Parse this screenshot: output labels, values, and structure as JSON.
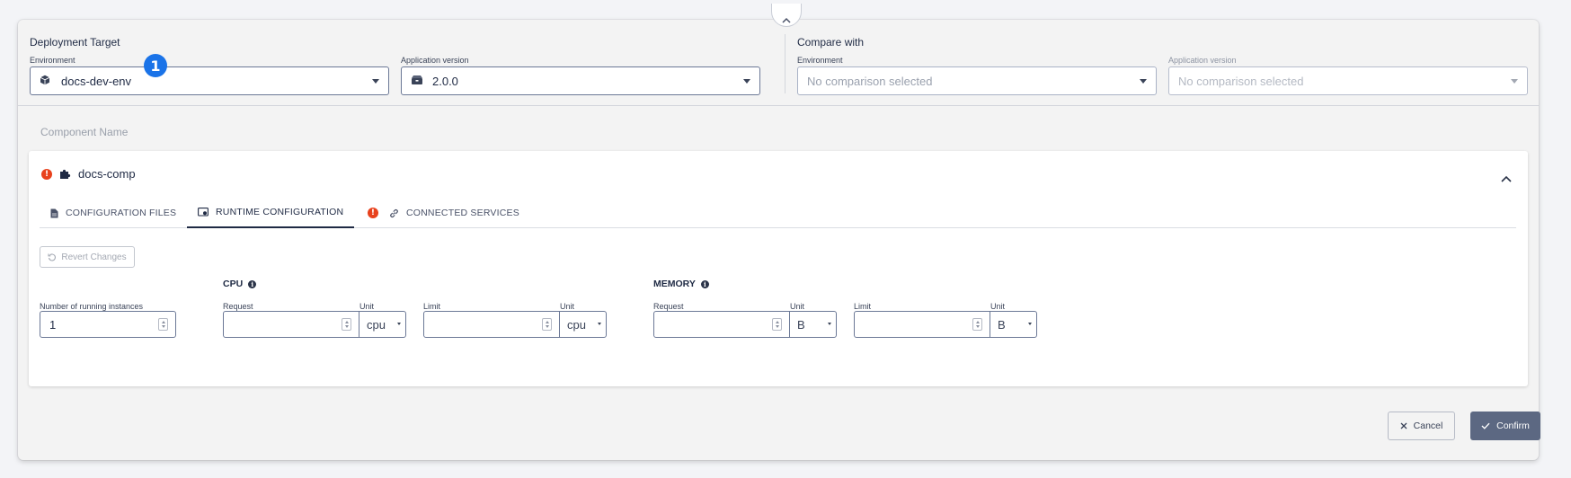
{
  "deployment": {
    "title": "Deployment Target",
    "environment_label": "Environment",
    "environment_value": "docs-dev-env",
    "version_label": "Application version",
    "version_value": "2.0.0"
  },
  "compare": {
    "title": "Compare with",
    "environment_label": "Environment",
    "environment_placeholder": "No comparison selected",
    "version_label": "Application version",
    "version_placeholder": "No comparison selected"
  },
  "component": {
    "heading": "Component Name",
    "name": "docs-comp",
    "error_glyph": "!"
  },
  "tabs": [
    {
      "label": "Configuration Files",
      "icon": "file-icon"
    },
    {
      "label": "Runtime Configuration",
      "icon": "runtime-config-icon",
      "active": true
    },
    {
      "label": "Connected Services",
      "icon": "link-icon",
      "has_error": true
    }
  ],
  "marker": {
    "number": "1",
    "color": "#1a73e8"
  },
  "runtime": {
    "revert_label": "Revert Changes",
    "instances_label": "Number of running instances",
    "instances_value": "1",
    "cpu": {
      "title": "CPU",
      "request_label": "Request",
      "request_value": "",
      "request_unit_label": "Unit",
      "request_unit": "cpu",
      "limit_label": "Limit",
      "limit_value": "",
      "limit_unit_label": "Unit",
      "limit_unit": "cpu"
    },
    "memory": {
      "title": "MEMORY",
      "request_label": "Request",
      "request_value": "",
      "request_unit_label": "Unit",
      "request_unit": "B",
      "limit_label": "Limit",
      "limit_value": "",
      "limit_unit_label": "Unit",
      "limit_unit": "B"
    }
  },
  "footer": {
    "cancel_label": "Cancel",
    "confirm_label": "Confirm"
  },
  "colors": {
    "accent_dark": "#1f2a44",
    "error": "#e8411c",
    "confirm_bg": "#5c6882"
  }
}
